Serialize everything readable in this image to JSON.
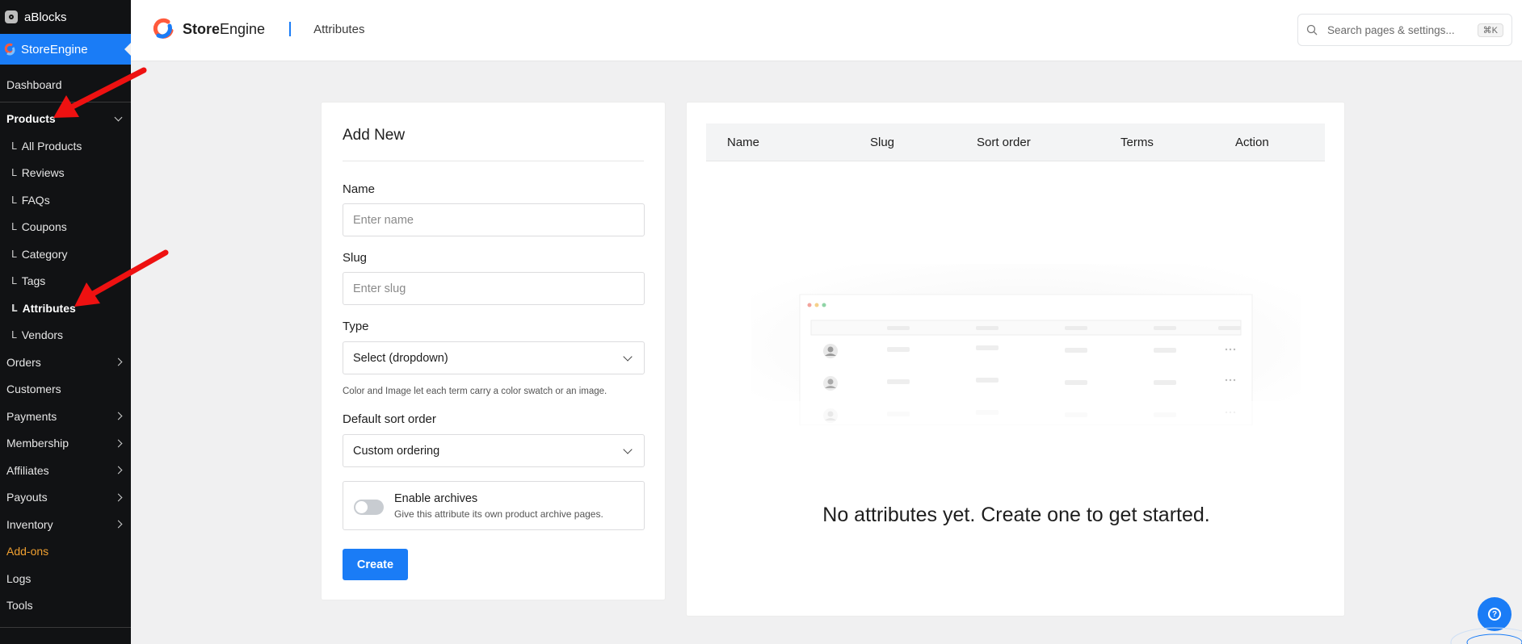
{
  "sidebar": {
    "site_name": "aBlocks",
    "plugin_name": "StoreEngine",
    "items": [
      {
        "label": "Dashboard"
      },
      {
        "label": "Products"
      },
      {
        "label": "All Products"
      },
      {
        "label": "Reviews"
      },
      {
        "label": "FAQs"
      },
      {
        "label": "Coupons"
      },
      {
        "label": "Category"
      },
      {
        "label": "Tags"
      },
      {
        "label": "Attributes"
      },
      {
        "label": "Vendors"
      },
      {
        "label": "Orders"
      },
      {
        "label": "Customers"
      },
      {
        "label": "Payments"
      },
      {
        "label": "Membership"
      },
      {
        "label": "Affiliates"
      },
      {
        "label": "Payouts"
      },
      {
        "label": "Inventory"
      },
      {
        "label": "Add-ons"
      },
      {
        "label": "Logs"
      },
      {
        "label": "Tools"
      }
    ],
    "sub_prefix": "Ⅼ",
    "accent_color": "#1a7cf6",
    "addon_color": "#f0a030"
  },
  "header": {
    "brand_bold": "Store",
    "brand_light": "Engine",
    "page": "Attributes",
    "search_placeholder": "Search pages & settings...",
    "search_shortcut": "⌘K"
  },
  "form": {
    "title": "Add New",
    "name_label": "Name",
    "name_placeholder": "Enter name",
    "slug_label": "Slug",
    "slug_placeholder": "Enter slug",
    "type_label": "Type",
    "type_value": "Select (dropdown)",
    "type_hint": "Color and Image let each term carry a color swatch or an image.",
    "sort_label": "Default sort order",
    "sort_value": "Custom ordering",
    "archives_title": "Enable archives",
    "archives_desc": "Give this attribute its own product archive pages.",
    "archives_enabled": false,
    "create_label": "Create"
  },
  "table": {
    "columns": [
      "Name",
      "Slug",
      "Sort order",
      "Terms",
      "Action"
    ],
    "empty_message": "No attributes yet. Create one to get started."
  }
}
